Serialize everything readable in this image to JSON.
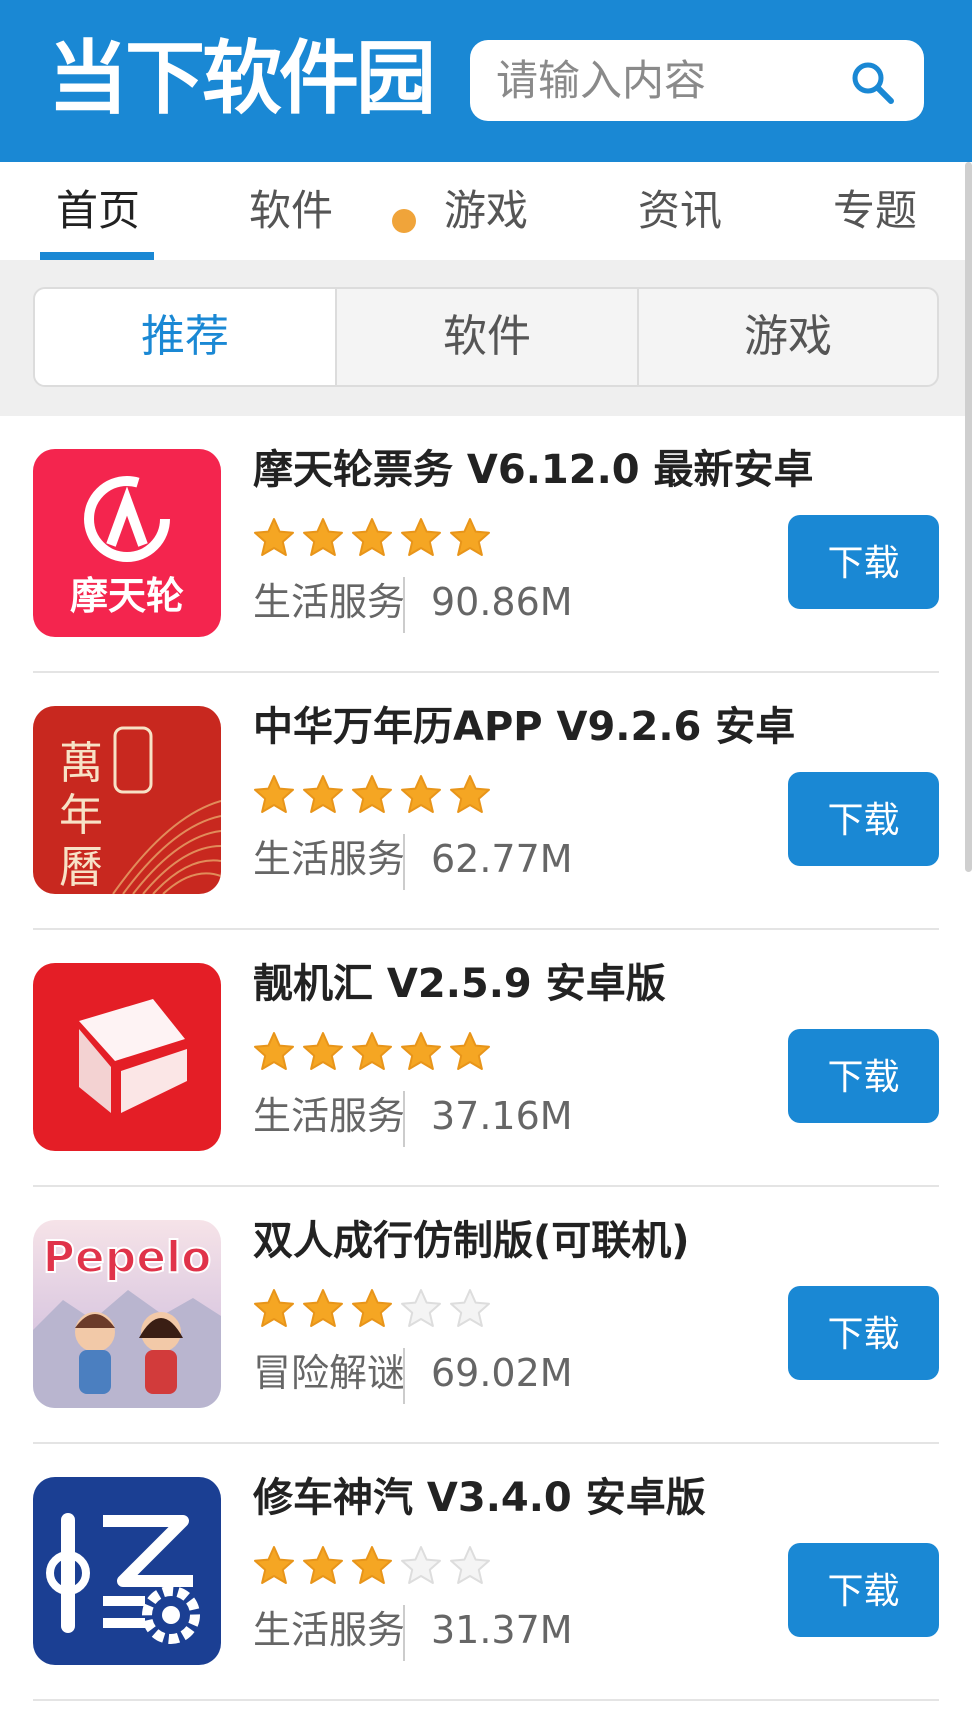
{
  "header": {
    "logo": "当下软件园",
    "search_placeholder": "请输入内容"
  },
  "nav": {
    "tabs": [
      {
        "label": "首页",
        "active": true
      },
      {
        "label": "软件"
      },
      {
        "label": "游戏",
        "hot": true
      },
      {
        "label": "资讯"
      },
      {
        "label": "专题"
      }
    ]
  },
  "subtabs": [
    "推荐",
    "软件",
    "游戏"
  ],
  "download_label": "下载",
  "apps": [
    {
      "title": "摩天轮票务 V6.12.0 最新安卓",
      "rating": 5,
      "category": "生活服务",
      "size": "90.86M",
      "icon": "motianlun-icon",
      "icon_text": "摩天轮"
    },
    {
      "title": "中华万年历APP V9.2.6 安卓",
      "rating": 5,
      "category": "生活服务",
      "size": "62.77M",
      "icon": "wannianli-icon",
      "icon_text": "萬年曆"
    },
    {
      "title": "靓机汇 V2.5.9 安卓版",
      "rating": 5,
      "category": "生活服务",
      "size": "37.16M",
      "icon": "liangjihui-icon"
    },
    {
      "title": "双人成行仿制版(可联机)",
      "rating": 3,
      "category": "冒险解谜",
      "size": "69.02M",
      "icon": "pepelo-icon",
      "icon_text": "Pepelo"
    },
    {
      "title": "修车神汽 V3.4.0 安卓版",
      "rating": 3,
      "category": "生活服务",
      "size": "31.37M",
      "icon": "xiuche-icon"
    }
  ],
  "colors": {
    "brand": "#1a88d4",
    "star": "#f5a623",
    "star_empty": "#dddddd"
  }
}
